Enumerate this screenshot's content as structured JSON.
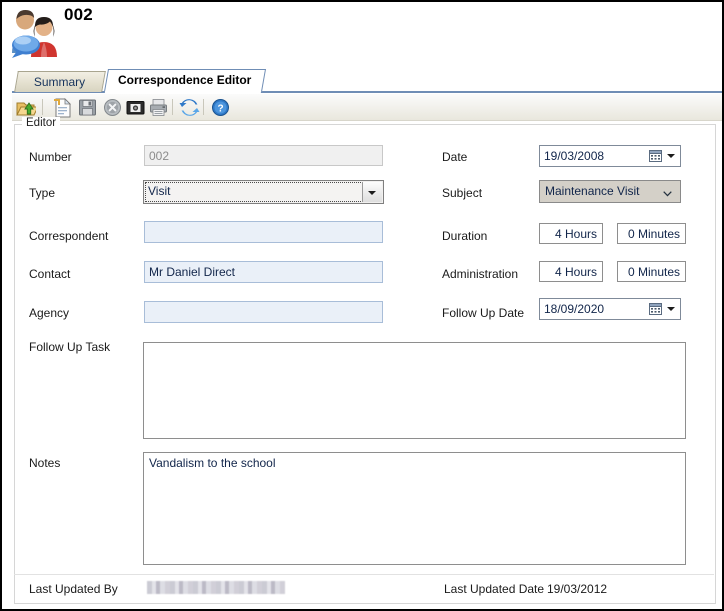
{
  "window": {
    "title": "002",
    "icon": "contacts-correspondence-icon"
  },
  "tabs": [
    {
      "label": "Summary",
      "active": false
    },
    {
      "label": "Correspondence Editor",
      "active": true
    }
  ],
  "toolbar": {
    "buttons": [
      {
        "name": "export-icon",
        "title": "Export"
      },
      {
        "name": "new-document-icon",
        "title": "New"
      },
      {
        "name": "save-icon",
        "title": "Save"
      },
      {
        "name": "delete-icon",
        "title": "Delete"
      },
      {
        "name": "photo-icon",
        "title": "Photo"
      },
      {
        "name": "print-icon",
        "title": "Print"
      },
      {
        "name": "refresh-icon",
        "title": "Refresh"
      },
      {
        "name": "help-icon",
        "title": "Help"
      }
    ]
  },
  "groupbox": {
    "legend": "Editor"
  },
  "form": {
    "number": {
      "label": "Number",
      "value": "002"
    },
    "type": {
      "label": "Type",
      "value": "Visit"
    },
    "correspondent": {
      "label": "Correspondent",
      "value": ""
    },
    "contact": {
      "label": "Contact",
      "value": "Mr Daniel Direct"
    },
    "agency": {
      "label": "Agency",
      "value": ""
    },
    "follow_up_task": {
      "label": "Follow Up Task",
      "value": ""
    },
    "notes": {
      "label": "Notes",
      "value": "Vandalism to the school"
    },
    "date": {
      "label": "Date",
      "value": "19/03/2008"
    },
    "subject": {
      "label": "Subject",
      "value": "Maintenance Visit"
    },
    "duration": {
      "label": "Duration",
      "hours": "4 Hours",
      "minutes": "0 Minutes"
    },
    "administration": {
      "label": "Administration",
      "hours": "4 Hours",
      "minutes": "0 Minutes"
    },
    "follow_up_date": {
      "label": "Follow Up Date",
      "value": "18/09/2020"
    }
  },
  "footer": {
    "last_updated_by_label": "Last Updated By",
    "last_updated_by_value": "",
    "last_updated_date_label": "Last Updated Date",
    "last_updated_date_value": "19/03/2012"
  },
  "colors": {
    "tab_active_border": "#6f8db5",
    "field_blue_bg": "#eaf0f8",
    "field_blue_border": "#a8bdd8",
    "text": "#11254a"
  }
}
